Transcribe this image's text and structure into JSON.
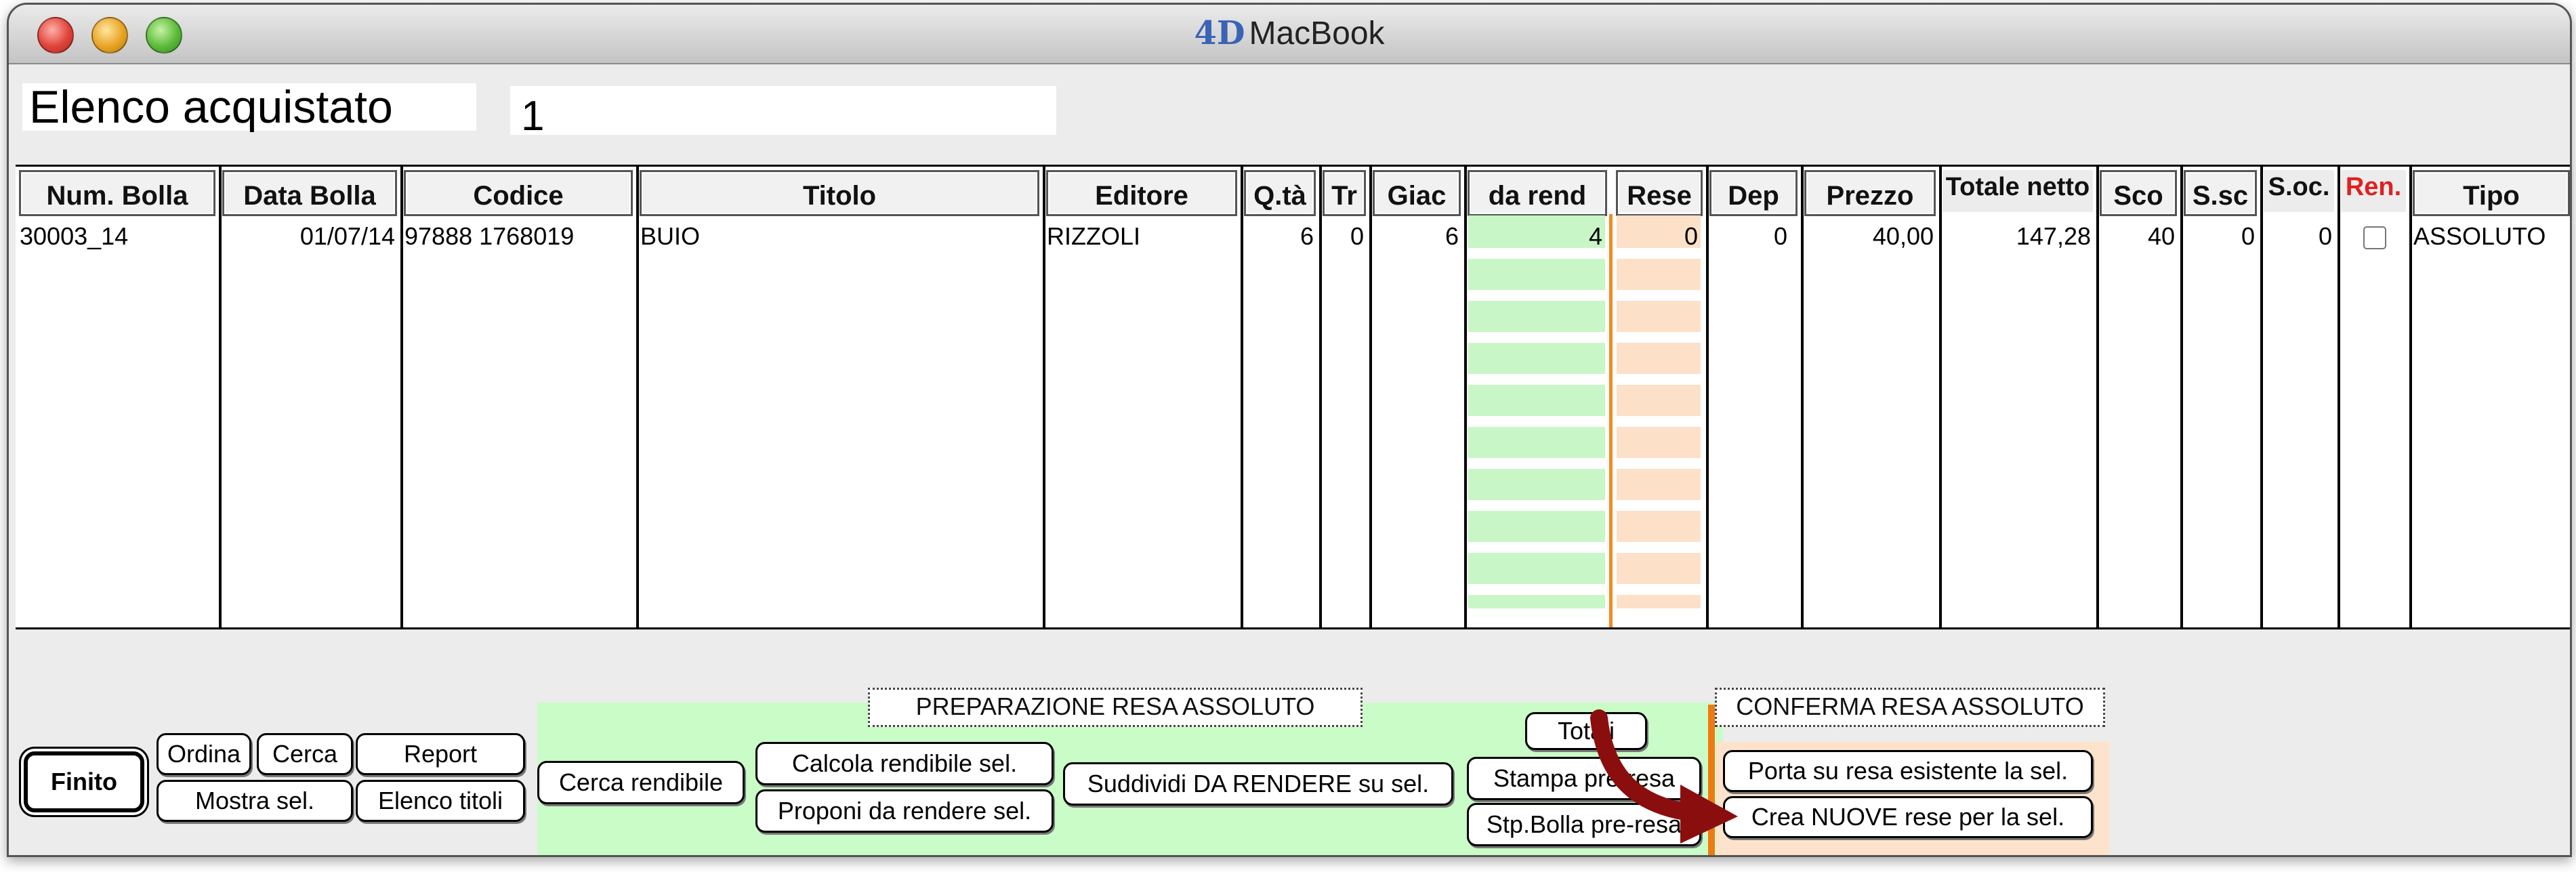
{
  "window": {
    "title": "MacBook"
  },
  "header": {
    "title": "Elenco acquistato",
    "count": "1"
  },
  "columns": [
    {
      "key": "num_bolla",
      "label": "Num. Bolla"
    },
    {
      "key": "data_bolla",
      "label": "Data Bolla"
    },
    {
      "key": "codice",
      "label": "Codice"
    },
    {
      "key": "titolo",
      "label": "Titolo"
    },
    {
      "key": "editore",
      "label": "Editore"
    },
    {
      "key": "qta",
      "label": "Q.tà"
    },
    {
      "key": "tr",
      "label": "Tr"
    },
    {
      "key": "giac",
      "label": "Giac"
    },
    {
      "key": "da_rend",
      "label": "da rend"
    },
    {
      "key": "rese",
      "label": "Rese"
    },
    {
      "key": "dep",
      "label": "Dep"
    },
    {
      "key": "prezzo",
      "label": "Prezzo"
    },
    {
      "key": "totale_netto",
      "label": "Totale netto"
    },
    {
      "key": "sco",
      "label": "Sco"
    },
    {
      "key": "s_sc",
      "label": "S.sc"
    },
    {
      "key": "s_oc",
      "label": "S.oc."
    },
    {
      "key": "ren",
      "label": "Ren."
    },
    {
      "key": "tipo",
      "label": "Tipo"
    }
  ],
  "rows": [
    {
      "num_bolla": "30003_14",
      "data_bolla": "01/07/14",
      "codice": "97888 1768019",
      "titolo": "BUIO",
      "editore": "RIZZOLI",
      "qta": "6",
      "tr": "0",
      "giac": "6",
      "da_rend": "4",
      "rese": "0",
      "dep": "0",
      "prezzo": "40,00",
      "totale_netto": "147,28",
      "sco": "40",
      "s_sc": "0",
      "s_oc": "0",
      "ren": false,
      "tipo": "ASSOLUTO"
    }
  ],
  "toolbar": {
    "finito": "Finito",
    "ordina": "Ordina",
    "cerca": "Cerca",
    "report": "Report",
    "mostra_sel": "Mostra sel.",
    "elenco_titoli": "Elenco titoli"
  },
  "preparazione": {
    "title": "PREPARAZIONE  RESA ASSOLUTO",
    "cerca_rendibile": "Cerca rendibile",
    "calcola_rendibile": "Calcola rendibile sel.",
    "proponi_da_rendere": "Proponi da rendere sel.",
    "suddividi": "Suddividi DA RENDERE su sel.",
    "totali": "Totali",
    "stampa_preresa": "Stampa pre-resa",
    "stp_bolla_preresa": "Stp.Bolla pre-resa"
  },
  "conferma": {
    "title": "CONFERMA RESA ASSOLUTO",
    "porta_su_resa": "Porta su resa esistente la sel.",
    "crea_nuove_rese": "Crea NUOVE rese per la sel."
  },
  "colors": {
    "highlight_green": "#c9f6c6",
    "highlight_peach": "#fde0c8",
    "accent_orange": "#f07a12",
    "annotation_arrow": "#8b0e0e",
    "ren_label": "#e02020"
  }
}
